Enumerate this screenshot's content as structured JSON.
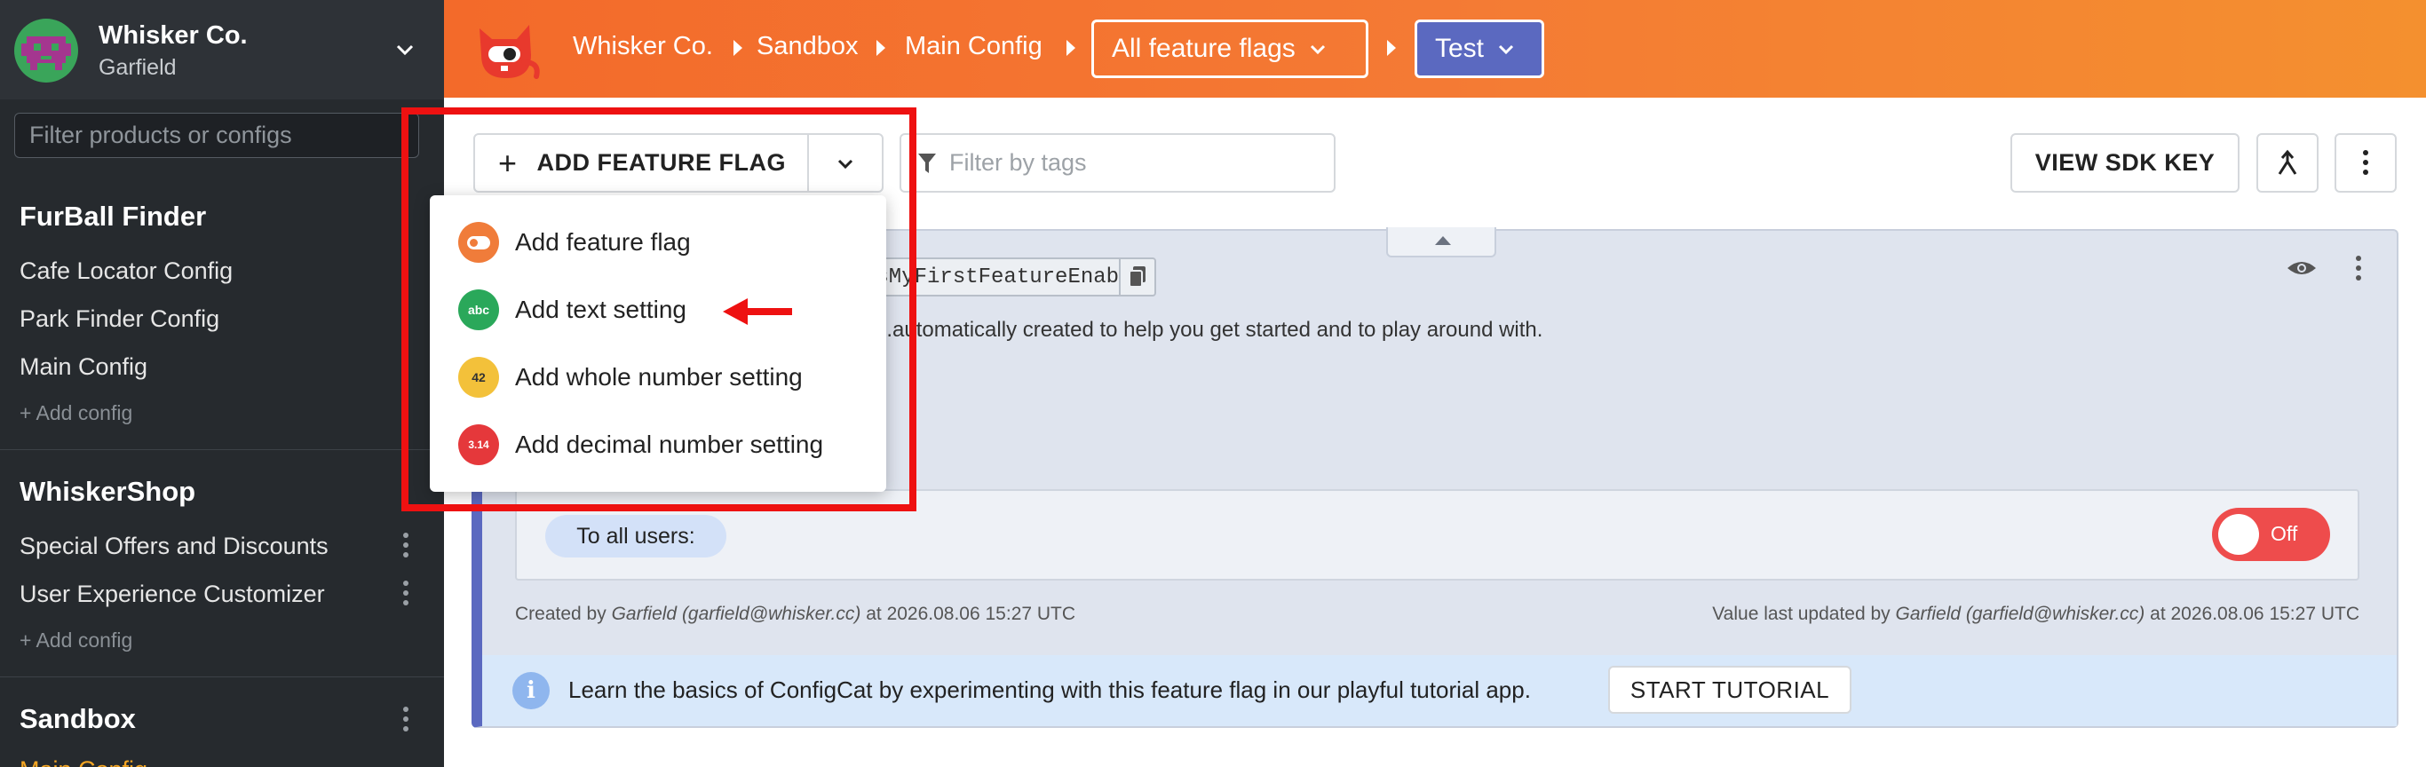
{
  "sidebar": {
    "org_name": "Whisker Co.",
    "org_user": "Garfield",
    "filter_placeholder": "Filter products or configs",
    "groups": [
      {
        "title": "FurBall Finder",
        "items": [
          {
            "label": "Cafe Locator Config"
          },
          {
            "label": "Park Finder Config"
          },
          {
            "label": "Main Config"
          }
        ],
        "add_label": "+ Add config"
      },
      {
        "title": "WhiskerShop",
        "items": [
          {
            "label": "Special Offers and Discounts"
          },
          {
            "label": "User Experience Customizer"
          }
        ],
        "add_label": "+ Add config"
      },
      {
        "title": "Sandbox",
        "items": [
          {
            "label": "Main Config"
          }
        ]
      }
    ]
  },
  "topbar": {
    "crumbs": [
      "Whisker Co.",
      "Sandbox",
      "Main Config"
    ],
    "view_select": "All feature flags",
    "env_select": "Test"
  },
  "toolbar": {
    "add_flag_label": "ADD FEATURE FLAG",
    "tag_filter_placeholder": "Filter by tags",
    "sdk_key_label": "VIEW SDK KEY"
  },
  "flag_card": {
    "key": "isMyFirstFeatureEnabled",
    "hint": "...automatically created to help you get started and to play around with.",
    "rule_label": "To all users:",
    "toggle_label": "Off",
    "created_prefix": "Created by",
    "created_user": "Garfield (garfield@whisker.cc)",
    "created_suffix": "at 2026.08.06 15:27 UTC",
    "updated_prefix": "Value last updated by",
    "updated_user": "Garfield (garfield@whisker.cc)",
    "updated_suffix": "at 2026.08.06 15:27 UTC",
    "tutorial_text": "Learn the basics of ConfigCat by experimenting with this feature flag in our playful tutorial app.",
    "tutorial_button": "START TUTORIAL"
  },
  "dropdown": {
    "items": [
      {
        "label": "Add feature flag",
        "badge": "",
        "color": "#f07c3a"
      },
      {
        "label": "Add text setting",
        "badge": "abc",
        "color": "#2aa85a"
      },
      {
        "label": "Add whole number setting",
        "badge": "42",
        "color": "#f3c13a"
      },
      {
        "label": "Add decimal number setting",
        "badge": "3.14",
        "color": "#e5383b"
      }
    ]
  },
  "colors": {
    "topbar_gradient_start": "#f36a2a",
    "topbar_gradient_end": "#f4902f",
    "env_accent": "#5b69c0",
    "toggle_off": "#ee4c4c",
    "annotation_red": "#ee1111"
  },
  "icons": [
    "chevron-down-icon",
    "cat-logo-icon",
    "filter-icon",
    "plus-icon",
    "merge-icon",
    "kebab-icon",
    "eye-icon",
    "copy-icon",
    "info-icon",
    "toggle-icon",
    "arrow-left-icon"
  ]
}
